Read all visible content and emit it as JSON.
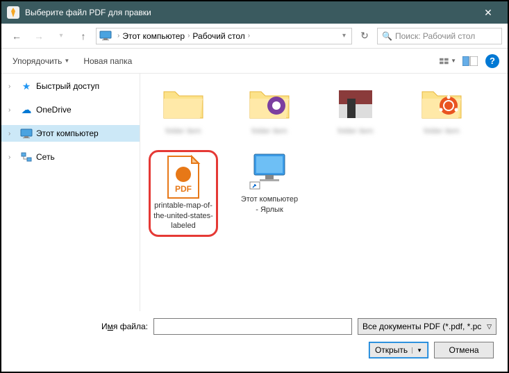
{
  "titlebar": {
    "title": "Выберите файл PDF для правки"
  },
  "breadcrumb": {
    "part1": "Этот компьютер",
    "part2": "Рабочий стол"
  },
  "search": {
    "placeholder": "Поиск: Рабочий стол"
  },
  "toolbar": {
    "organize": "Упорядочить",
    "newfolder": "Новая папка"
  },
  "sidebar": {
    "quick": "Быстрый доступ",
    "onedrive": "OneDrive",
    "thispc": "Этот компьютер",
    "network": "Сеть"
  },
  "files": {
    "pdf_label": "printable-map-of-the-united-states-labeled",
    "pc_label": "Этот компьютер - Ярлык",
    "half1": "Этот компьютер",
    "half2": "- Ярлык",
    "pdf_text": "PDF"
  },
  "bottom": {
    "filename_label_pre": "И",
    "filename_label_ul": "м",
    "filename_label_post": "я файла:",
    "filetype": "Все документы PDF (*.pdf, *.pс",
    "open": "Открыть",
    "cancel": "Отмена"
  }
}
